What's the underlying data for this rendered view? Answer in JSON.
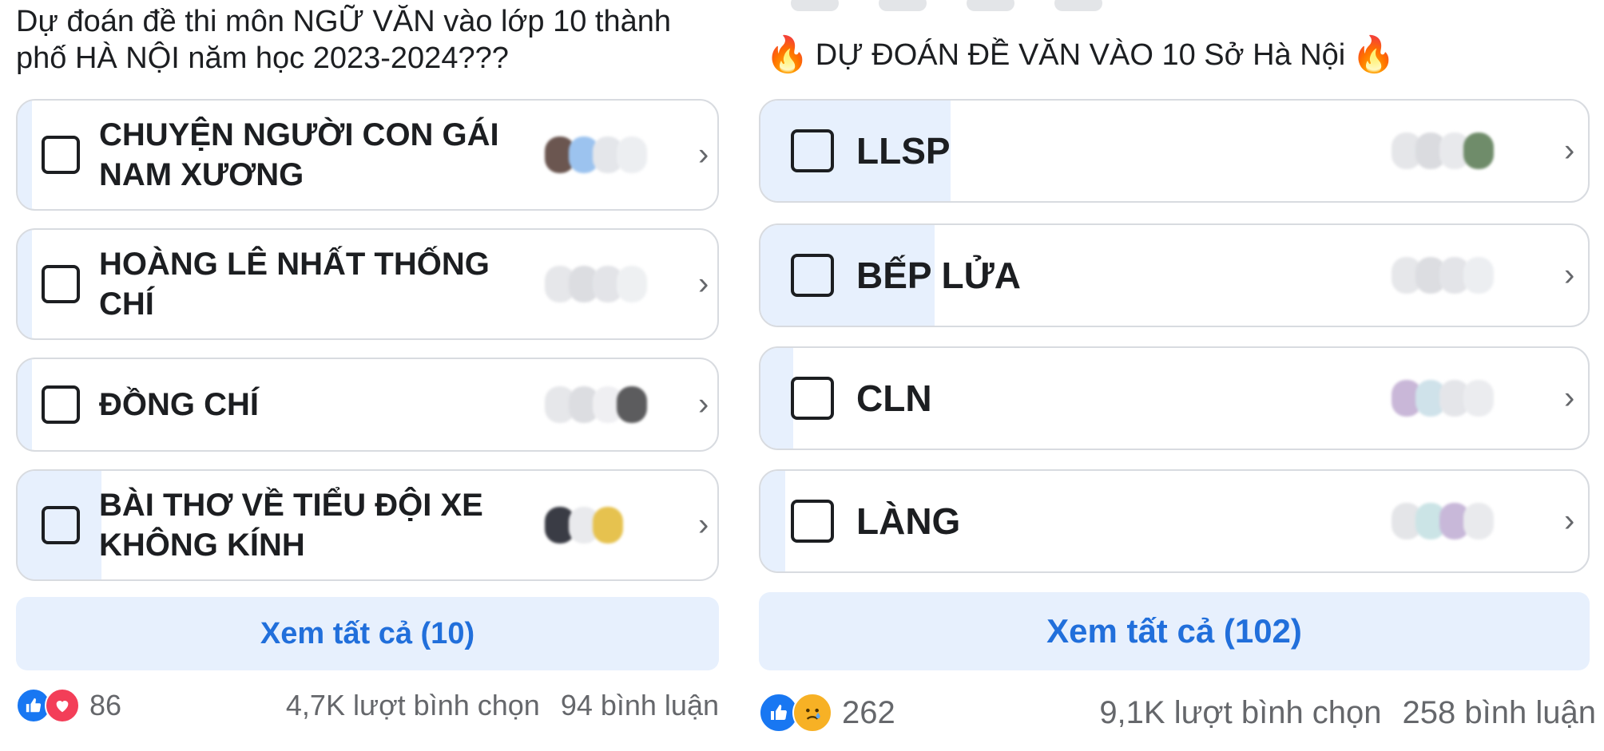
{
  "left_poll": {
    "title": "Dự đoán đề thi môn NGỮ VĂN vào lớp 10 thành phố HÀ NỘI năm học 2023-2024???",
    "options": [
      {
        "label": "CHUYỆN NGƯỜI CON GÁI NAM XƯƠNG",
        "fill": 0.02
      },
      {
        "label": "HOÀNG LÊ NHẤT THỐNG CHÍ",
        "fill": 0.02
      },
      {
        "label": "ĐỒNG CHÍ",
        "fill": 0.02
      },
      {
        "label": "BÀI THƠ VỀ TIỂU ĐỘI XE KHÔNG KÍNH",
        "fill": 0.12
      }
    ],
    "see_all": "Xem tất cả (10)",
    "reaction_count": "86",
    "votes": "4,7K lượt bình chọn",
    "comments": "94 bình luận",
    "reactions": [
      "like-icon",
      "love-icon"
    ]
  },
  "right_poll": {
    "title": "DỰ ĐOÁN ĐỀ VĂN VÀO 10 Sở Hà Nội",
    "title_emoji": "🔥",
    "options": [
      {
        "label": "LLSP",
        "fill": 0.23
      },
      {
        "label": "BẾP LỬA",
        "fill": 0.21
      },
      {
        "label": "CLN",
        "fill": 0.04
      },
      {
        "label": "LÀNG",
        "fill": 0.03
      }
    ],
    "see_all": "Xem tất cả (102)",
    "reaction_count": "262",
    "votes": "9,1K lượt bình chọn",
    "comments": "258 bình luận",
    "reactions": [
      "like-icon",
      "sad-icon"
    ]
  },
  "colors": {
    "accent": "#216fdb",
    "fill": "#e7f0fd",
    "like": "#1877f2",
    "love": "#f33e58",
    "sad": "#f7b125"
  },
  "chevron": "›"
}
